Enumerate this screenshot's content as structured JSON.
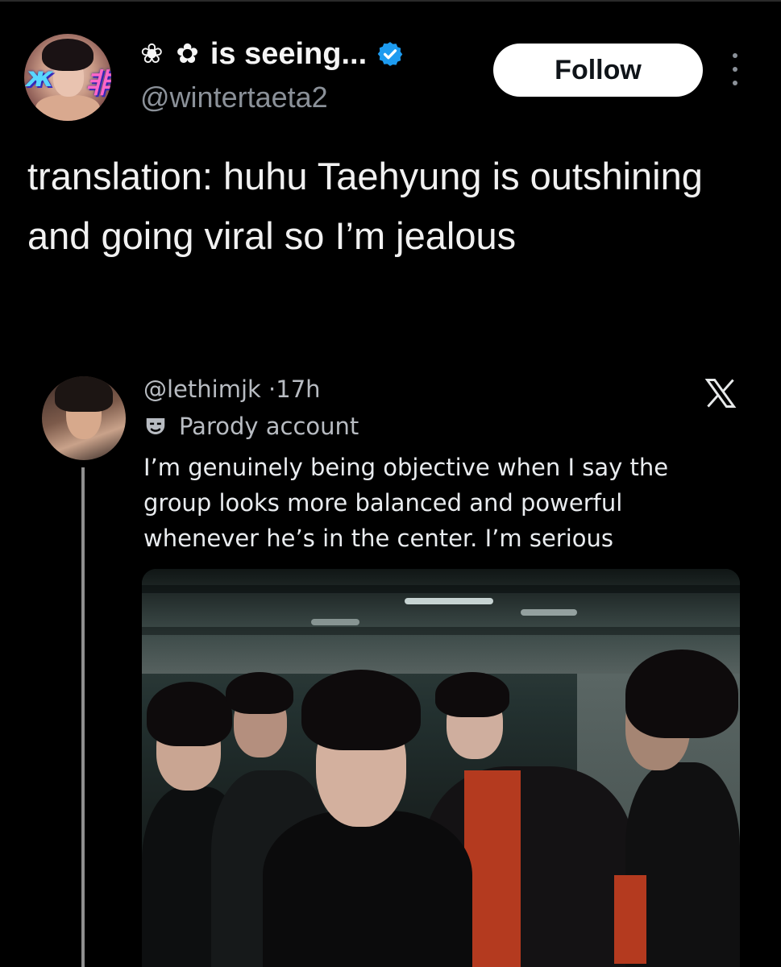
{
  "tweet": {
    "display_name_symbols": "❀ ✿",
    "display_name": "is seeing...",
    "handle": "@wintertaeta2",
    "follow_label": "Follow",
    "text": "translation: huhu Taehyung is outshining and going viral so I’m jealous"
  },
  "quoted": {
    "handle": "@lethimjk",
    "separator": "·",
    "time": "17h",
    "label": "Parody account",
    "text": "I’m genuinely being objective when I say the group looks more balanced and powerful whenever he’s in the center. I’m serious"
  },
  "colors": {
    "background": "#000000",
    "verified_badge": "#1d9bf0",
    "follow_button": "#ffffff",
    "muted_text": "#8b9199"
  },
  "icons": {
    "verified": "verified-badge-icon",
    "more": "more-vertical-icon",
    "parody": "theater-mask-icon",
    "logo": "x-logo-icon"
  }
}
